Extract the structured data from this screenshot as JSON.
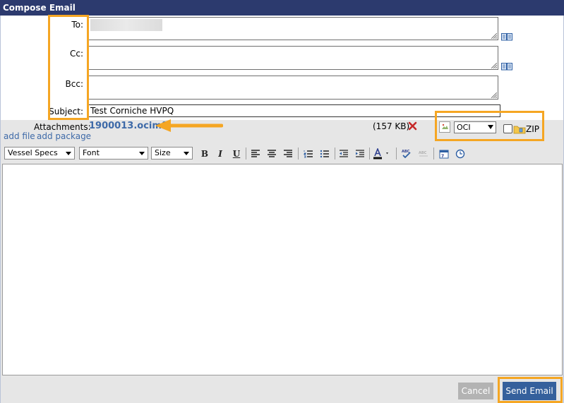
{
  "window": {
    "title": "Compose Email"
  },
  "fields": {
    "to_label": "To:",
    "cc_label": "Cc:",
    "bcc_label": "Bcc:",
    "subject_label": "Subject:",
    "subject_value": "Test Corniche HVPQ"
  },
  "attachments": {
    "label": "Attachments:",
    "filename": "1900013.ocimf",
    "size": "(157 KB)",
    "add_file": "add file",
    "add_package": "add package",
    "format_selected": "OCI",
    "zip_label": "ZIP"
  },
  "toolbar": {
    "style_select": "Vessel Specs",
    "font_select": "Font",
    "size_select": "Size",
    "bold": "B",
    "italic": "I",
    "underline": "U"
  },
  "actions": {
    "cancel": "Cancel",
    "send": "Send Email"
  },
  "colors": {
    "titlebar": "#2c3a6e",
    "link": "#3e6aa8",
    "send_button": "#35609c",
    "highlight": "#f5a623",
    "delete_icon": "#c62828"
  }
}
